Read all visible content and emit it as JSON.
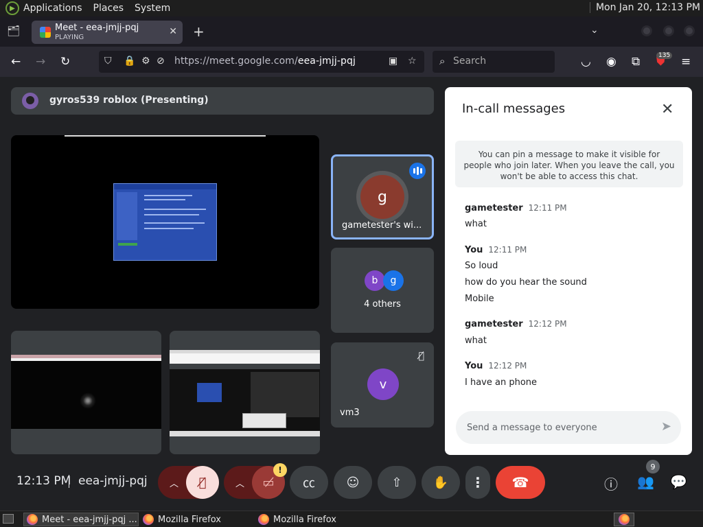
{
  "system_panel": {
    "menus": [
      "Applications",
      "Places",
      "System"
    ],
    "clock": "Mon Jan 20, 12:13 PM"
  },
  "browser": {
    "tab": {
      "title": "Meet - eea-jmjj-pqj",
      "status": "PLAYING"
    },
    "url_host": "https://meet.google.com/",
    "url_path": "eea-jmjj-pqj",
    "search_placeholder": "Search",
    "extension_badge": "135"
  },
  "meet": {
    "presenter": "gyros539 roblox (Presenting)",
    "participants": {
      "gametester": {
        "initial": "g",
        "label": "gametester's wi..."
      },
      "others": {
        "initials": [
          "b",
          "g"
        ],
        "colors": [
          "#7f46c7",
          "#1a73e8"
        ],
        "label": "4 others"
      },
      "vm3": {
        "initial": "v",
        "label": "vm3"
      }
    },
    "time": "12:13 PM",
    "meeting_code": "eea-jmjj-pqj",
    "warning_badge": "!",
    "people_count": "9"
  },
  "chat": {
    "title": "In-call messages",
    "pin_note": "You can pin a message to make it visible for people who join later. When you leave the call, you won't be able to access this chat.",
    "messages": [
      {
        "sender": "gametester",
        "time": "12:11 PM",
        "lines": [
          "what"
        ]
      },
      {
        "sender": "You",
        "time": "12:11 PM",
        "lines": [
          "So loud",
          "how do you hear the sound",
          "Mobile"
        ]
      },
      {
        "sender": "gametester",
        "time": "12:12 PM",
        "lines": [
          "what"
        ]
      },
      {
        "sender": "You",
        "time": "12:12 PM",
        "lines": [
          "I have an phone"
        ]
      }
    ],
    "input_placeholder": "Send a message to everyone"
  },
  "taskbar": {
    "items": [
      "Meet - eea-jmjj-pqj ...",
      "Mozilla Firefox",
      "Mozilla Firefox"
    ]
  },
  "colors": {
    "meet_bg": "#202124",
    "tile_bg": "#3c4043",
    "leave_red": "#ea4335",
    "active_border": "#8ab4f8",
    "muted_red": "#5c1a1a"
  }
}
